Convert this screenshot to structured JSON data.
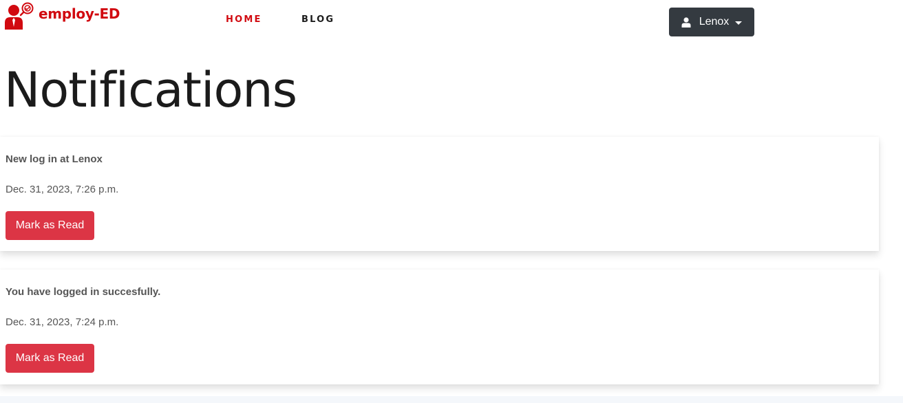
{
  "brand": {
    "name": "employ-ED",
    "color": "#d10a10",
    "logo_icon": "person-tie-search-icon"
  },
  "nav": {
    "items": [
      {
        "label": "HOME",
        "active": true,
        "color": "#d10a10"
      },
      {
        "label": "BLOG",
        "active": false,
        "color": "#1b1b1b"
      }
    ]
  },
  "user_menu": {
    "username": "Lenox",
    "icon": "user-icon",
    "background": "#343a40"
  },
  "page": {
    "title": "Notifications"
  },
  "notifications": [
    {
      "title": "New log in at Lenox",
      "date": "Dec. 31, 2023, 7:26 p.m.",
      "action_label": "Mark as Read"
    },
    {
      "title": "You have logged in succesfully.",
      "date": "Dec. 31, 2023, 7:24 p.m.",
      "action_label": "Mark as Read"
    }
  ],
  "colors": {
    "accent": "#dc3545",
    "text_muted": "#555555"
  }
}
